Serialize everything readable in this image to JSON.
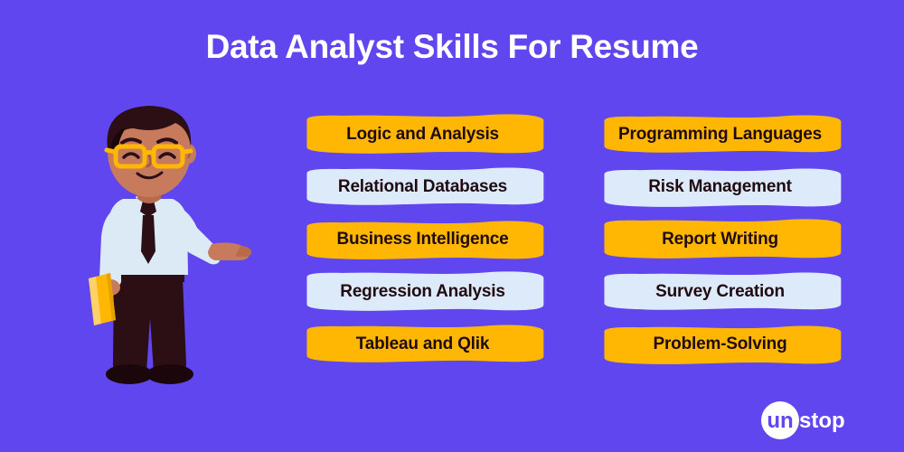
{
  "header": {
    "title": "Data Analyst Skills For Resume"
  },
  "theme": {
    "background": "#6046EE",
    "pill_yellow": "#FFB703",
    "pill_blue": "#DDEAFA",
    "pill_text": "#1F0B10",
    "title_color": "#FFFFFF",
    "skin": "#C87B5C",
    "hair": "#2B0F14",
    "shirt": "#DCEAF5",
    "trousers": "#2B0F14",
    "glasses": "#FFB703",
    "book": "#FFB703"
  },
  "illustration": {
    "name": "business-analyst-character",
    "description": "Smiling man with glasses in light blue shirt and dark tie, holding a yellow folder, one arm outstretched toward the skill list"
  },
  "skills": {
    "left_column": [
      {
        "label": "Logic and Analysis",
        "style": "yellow"
      },
      {
        "label": "Relational Databases",
        "style": "blue"
      },
      {
        "label": "Business Intelligence",
        "style": "yellow"
      },
      {
        "label": "Regression Analysis",
        "style": "blue"
      },
      {
        "label": "Tableau and Qlik",
        "style": "yellow"
      }
    ],
    "right_column": [
      {
        "label": "Programming Languages",
        "style": "yellow"
      },
      {
        "label": "Risk Management",
        "style": "blue"
      },
      {
        "label": "Report Writing",
        "style": "yellow"
      },
      {
        "label": "Survey Creation",
        "style": "blue"
      },
      {
        "label": "Problem-Solving",
        "style": "yellow"
      }
    ]
  },
  "footer": {
    "logo_text_primary": "un",
    "logo_text_secondary": "stop",
    "logo_full": "unstop"
  }
}
